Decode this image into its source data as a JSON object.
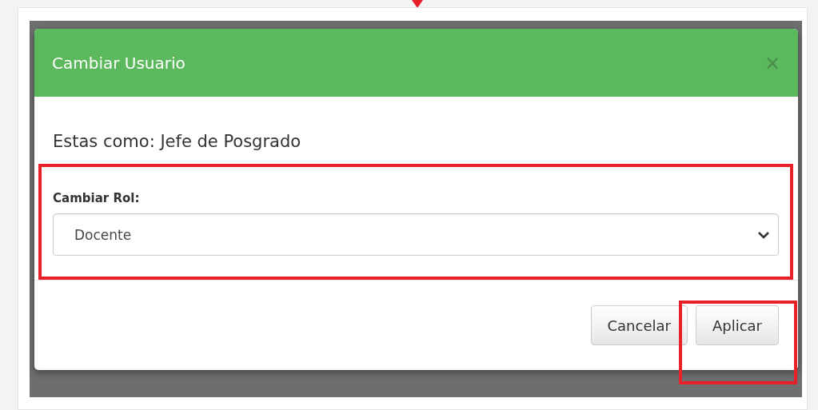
{
  "modal": {
    "title": "Cambiar Usuario",
    "close": "×",
    "message": "Estas como: Jefe de Posgrado",
    "field": {
      "label": "Cambiar Rol:",
      "value": "Docente"
    },
    "buttons": [
      "Cancelar",
      "Aplicar"
    ]
  }
}
